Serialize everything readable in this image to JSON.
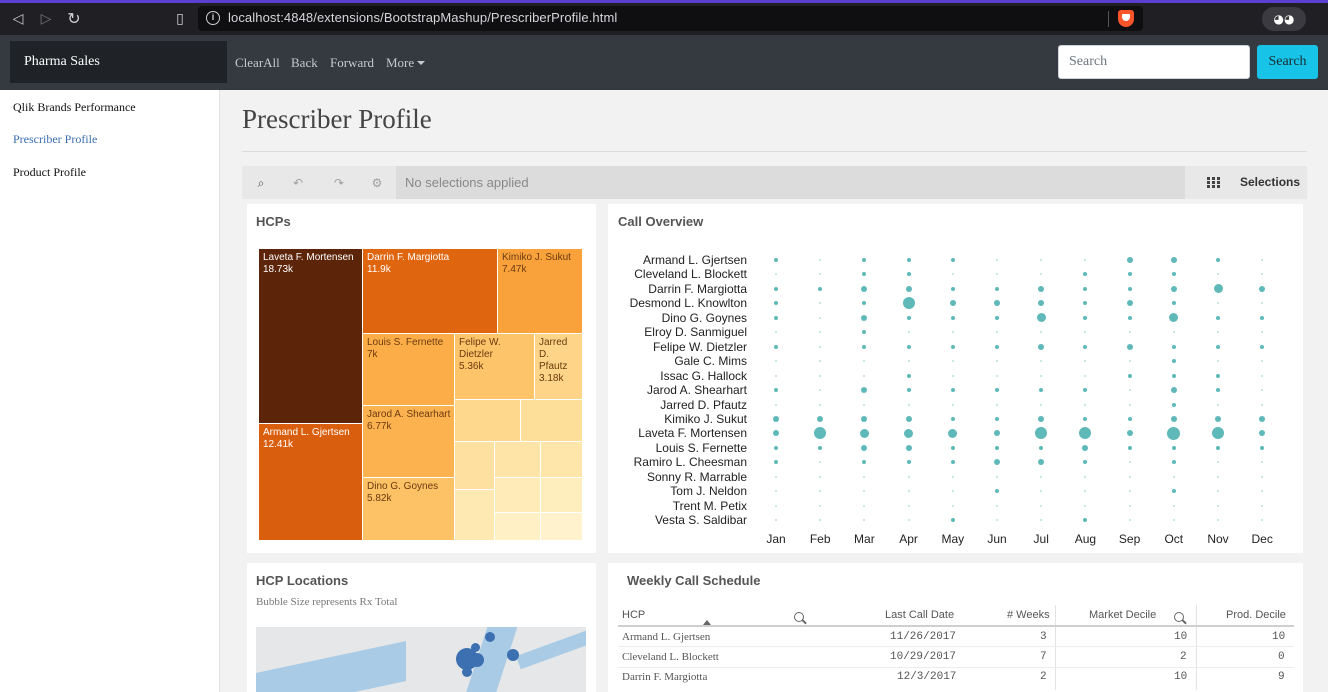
{
  "browser": {
    "url": "localhost:4848/extensions/BootstrapMashup/PrescriberProfile.html",
    "back_glyph": "◁",
    "forward_glyph": "▷",
    "reload_glyph": "↻",
    "bookmark_glyph": "▯",
    "info_glyph": "i",
    "extension_glyph": "◕◕"
  },
  "navbar": {
    "brand": "Pharma Sales",
    "links": [
      "ClearAll",
      "Back",
      "Forward",
      "More"
    ],
    "search_placeholder": "Search",
    "search_button": "Search"
  },
  "sidebar": {
    "items": [
      {
        "label": "Qlik Brands Performance",
        "active": false
      },
      {
        "label": "Prescriber Profile",
        "active": true
      },
      {
        "label": "Product Profile",
        "active": false
      }
    ]
  },
  "page": {
    "title": "Prescriber Profile"
  },
  "selections": {
    "status": "No selections applied",
    "label": "Selections",
    "tool_icons": [
      "⌕",
      "↶",
      "↷",
      "⚙"
    ]
  },
  "hcps": {
    "title": "HCPs",
    "tiles": [
      {
        "name": "Laveta F. Mortensen",
        "value": "18.73k",
        "color": "#5c2408",
        "text": "#ffffff"
      },
      {
        "name": "Armand L. Gjertsen",
        "value": "12.41k",
        "color": "#d95f0e",
        "text": "#ffffff"
      },
      {
        "name": "Darrin F. Margiotta",
        "value": "11.9k",
        "color": "#e0650f",
        "text": "#ffffff"
      },
      {
        "name": "Kimiko J. Sukut",
        "value": "7.47k",
        "color": "#f9a23c",
        "text": "#6b3a10"
      },
      {
        "name": "Louis S. Fernette",
        "value": "7k",
        "color": "#fcad48",
        "text": "#6b3a10"
      },
      {
        "name": "Felipe W. Dietzler",
        "value": "5.36k",
        "color": "#fdc46a",
        "text": "#6b3a10"
      },
      {
        "name": "Jarred D. Pfautz",
        "value": "3.18k",
        "color": "#fed588",
        "text": "#6b3a10"
      },
      {
        "name": "Jarod A. Shearhart",
        "value": "6.77k",
        "color": "#fcb24f",
        "text": "#6b3a10"
      },
      {
        "name": "Dino G. Goynes",
        "value": "5.82k",
        "color": "#fdc166",
        "text": "#6b3a10"
      }
    ]
  },
  "call_overview": {
    "title": "Call Overview",
    "prescribers": [
      "Armand L. Gjertsen",
      "Cleveland L. Blockett",
      "Darrin F. Margiotta",
      "Desmond L. Knowlton",
      "Dino G. Goynes",
      "Elroy D. Sanmiguel",
      "Felipe W. Dietzler",
      "Gale C. Mims",
      "Issac G. Hallock",
      "Jarod A. Shearhart",
      "Jarred D. Pfautz",
      "Kimiko J. Sukut",
      "Laveta F. Mortensen",
      "Louis S. Fernette",
      "Ramiro L. Cheesman",
      "Sonny R. Marrable",
      "Tom J. Neldon",
      "Trent M. Petix",
      "Vesta S. Saldibar"
    ],
    "months": [
      "Jan",
      "Feb",
      "Mar",
      "Apr",
      "May",
      "Jun",
      "Jul",
      "Aug",
      "Sep",
      "Oct",
      "Nov",
      "Dec"
    ],
    "calls": [
      [
        1,
        0,
        1,
        1,
        1,
        0,
        0,
        0,
        2,
        2,
        1,
        0
      ],
      [
        0,
        0,
        1,
        1,
        0,
        0,
        0,
        1,
        1,
        1,
        0,
        0
      ],
      [
        1,
        1,
        2,
        2,
        1,
        1,
        2,
        1,
        1,
        2,
        3,
        2
      ],
      [
        1,
        0,
        1,
        4,
        2,
        2,
        2,
        1,
        2,
        1,
        0,
        0
      ],
      [
        1,
        0,
        2,
        1,
        1,
        1,
        3,
        1,
        1,
        3,
        1,
        1
      ],
      [
        0,
        0,
        1,
        0,
        0,
        0,
        0,
        0,
        0,
        0,
        0,
        0
      ],
      [
        1,
        0,
        1,
        1,
        1,
        1,
        2,
        1,
        2,
        1,
        1,
        1
      ],
      [
        0,
        0,
        0,
        0,
        0,
        0,
        0,
        0,
        0,
        1,
        0,
        0
      ],
      [
        0,
        0,
        0,
        1,
        0,
        0,
        0,
        0,
        1,
        1,
        1,
        0
      ],
      [
        1,
        0,
        2,
        1,
        1,
        1,
        1,
        1,
        0,
        2,
        1,
        0
      ],
      [
        0,
        0,
        0,
        0,
        0,
        0,
        0,
        0,
        0,
        1,
        0,
        0
      ],
      [
        2,
        2,
        2,
        2,
        1,
        1,
        2,
        1,
        1,
        2,
        2,
        2
      ],
      [
        2,
        4,
        3,
        3,
        3,
        2,
        4,
        4,
        2,
        5,
        4,
        2
      ],
      [
        1,
        1,
        2,
        2,
        1,
        1,
        1,
        2,
        1,
        1,
        1,
        1
      ],
      [
        1,
        0,
        1,
        1,
        1,
        2,
        2,
        1,
        0,
        1,
        0,
        0
      ],
      [
        0,
        0,
        0,
        0,
        0,
        0,
        0,
        0,
        0,
        0,
        0,
        0
      ],
      [
        0,
        0,
        0,
        0,
        0,
        1,
        0,
        0,
        0,
        1,
        0,
        0
      ],
      [
        0,
        0,
        0,
        0,
        0,
        0,
        0,
        0,
        0,
        0,
        0,
        0
      ],
      [
        0,
        0,
        0,
        0,
        1,
        0,
        0,
        1,
        0,
        0,
        0,
        0
      ]
    ],
    "dot_color": "#5fb9b9"
  },
  "locations": {
    "title": "HCP Locations",
    "subtitle": "Bubble Size represents Rx Total"
  },
  "schedule": {
    "title": "Weekly Call Schedule",
    "headers": [
      "HCP",
      "Last Call Date",
      "# Weeks",
      "Market Decile",
      "Prod. Decile"
    ],
    "rows": [
      {
        "hcp": "Armand L. Gjertsen",
        "date": "11/26/2017",
        "weeks": "3",
        "market": "10",
        "prod": "10"
      },
      {
        "hcp": "Cleveland L. Blockett",
        "date": "10/29/2017",
        "weeks": "7",
        "market": "2",
        "prod": "0"
      },
      {
        "hcp": "Darrin F. Margiotta",
        "date": "12/3/2017",
        "weeks": "2",
        "market": "10",
        "prod": "9"
      }
    ]
  }
}
